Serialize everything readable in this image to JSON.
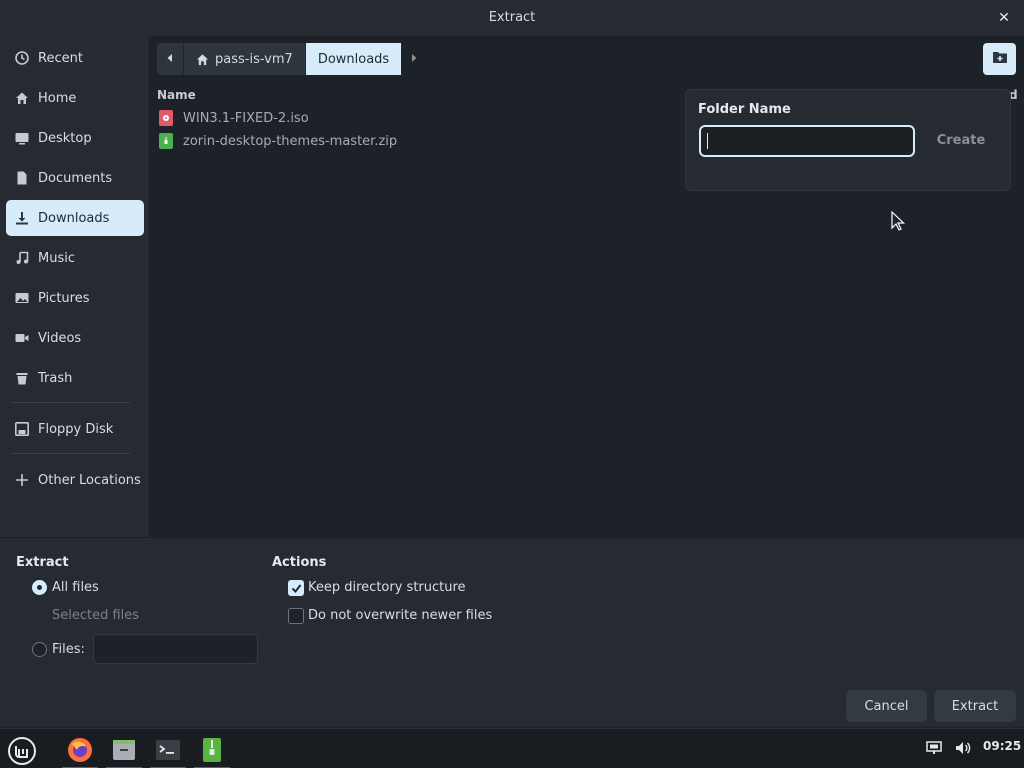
{
  "window": {
    "title": "Extract",
    "close_glyph": "✕"
  },
  "sidebar": {
    "items": [
      {
        "label": "Recent",
        "icon": "clock-icon"
      },
      {
        "label": "Home",
        "icon": "home-icon"
      },
      {
        "label": "Desktop",
        "icon": "desktop-icon"
      },
      {
        "label": "Documents",
        "icon": "document-icon"
      },
      {
        "label": "Downloads",
        "icon": "download-icon",
        "active": true
      },
      {
        "label": "Music",
        "icon": "music-icon"
      },
      {
        "label": "Pictures",
        "icon": "pictures-icon"
      },
      {
        "label": "Videos",
        "icon": "video-icon"
      },
      {
        "label": "Trash",
        "icon": "trash-icon"
      },
      {
        "label": "Floppy Disk",
        "icon": "floppy-icon"
      },
      {
        "label": "Other Locations",
        "icon": "plus-icon"
      }
    ]
  },
  "pathbar": {
    "segments": [
      {
        "label": "pass-is-vm7",
        "icon": "home-icon"
      },
      {
        "label": "Downloads",
        "active": true
      }
    ]
  },
  "filelist": {
    "header_name": "Name",
    "header_right_partial": "d",
    "files": [
      {
        "name": "WIN3.1-FIXED-2.iso",
        "icon": "disc-image-icon",
        "color": "#e05a6a"
      },
      {
        "name": "zorin-desktop-themes-master.zip",
        "icon": "archive-icon",
        "color": "#4caf50"
      }
    ]
  },
  "popover": {
    "label": "Folder Name",
    "input_value": "",
    "create_label": "Create"
  },
  "extract_options": {
    "title": "Extract",
    "all_files": "All files",
    "selected_files": "Selected files",
    "files_label": "Files:",
    "files_value": "",
    "selected": "all_files"
  },
  "actions": {
    "title": "Actions",
    "keep_structure": "Keep directory structure",
    "keep_structure_checked": true,
    "no_overwrite": "Do not overwrite newer files",
    "no_overwrite_checked": false
  },
  "buttons": {
    "cancel": "Cancel",
    "extract": "Extract"
  },
  "taskbar": {
    "apps": [
      "mint-menu-icon",
      "firefox-icon",
      "files-icon",
      "terminal-icon",
      "archive-manager-icon"
    ],
    "clock": "09:25"
  },
  "colors": {
    "accent": "#d6ecfb",
    "background": "#1d2228",
    "panel": "#262b31"
  }
}
